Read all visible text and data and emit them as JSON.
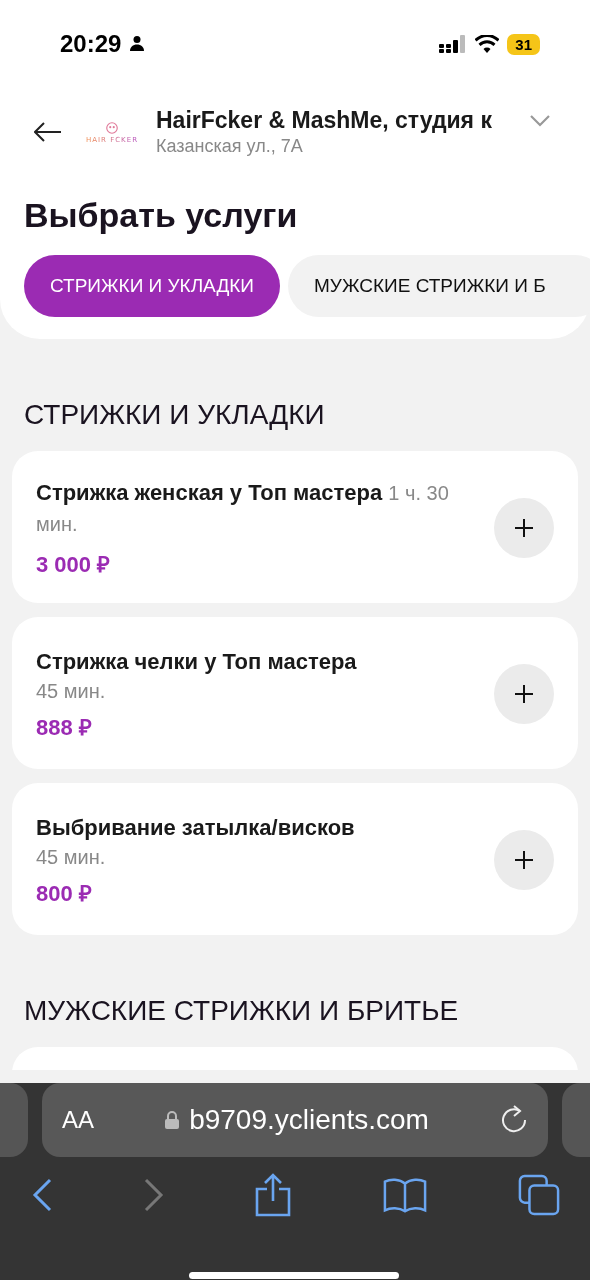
{
  "status_bar": {
    "time": "20:29",
    "battery": "31"
  },
  "header": {
    "logo_text": "HAIR FCKER",
    "title": "HairFcker & MashMe, студия к",
    "address": "Казанская ул., 7А"
  },
  "page_title": "Выбрать услуги",
  "tabs": [
    {
      "label": "СТРИЖКИ И УКЛАДКИ",
      "selected": true
    },
    {
      "label": "МУЖСКИЕ СТРИЖКИ И Б",
      "selected": false
    }
  ],
  "sections": [
    {
      "title": "СТРИЖКИ И УКЛАДКИ",
      "services": [
        {
          "kind": "inline",
          "name": "Стрижка женская у Топ мастера",
          "duration": "1 ч. 30 мин.",
          "price": "3 000 ₽"
        },
        {
          "kind": "stacked",
          "name": "Стрижка челки у Топ мастера",
          "duration": "45 мин.",
          "price": "888 ₽"
        },
        {
          "kind": "stacked",
          "name": "Выбривание затылка/висков",
          "duration": "45 мин.",
          "price": "800 ₽"
        }
      ]
    },
    {
      "title": "МУЖСКИЕ СТРИЖКИ И БРИТЬЕ"
    }
  ],
  "browser": {
    "text_size": "AA",
    "url": "b9709.yclients.com",
    "forward_disabled": true
  }
}
